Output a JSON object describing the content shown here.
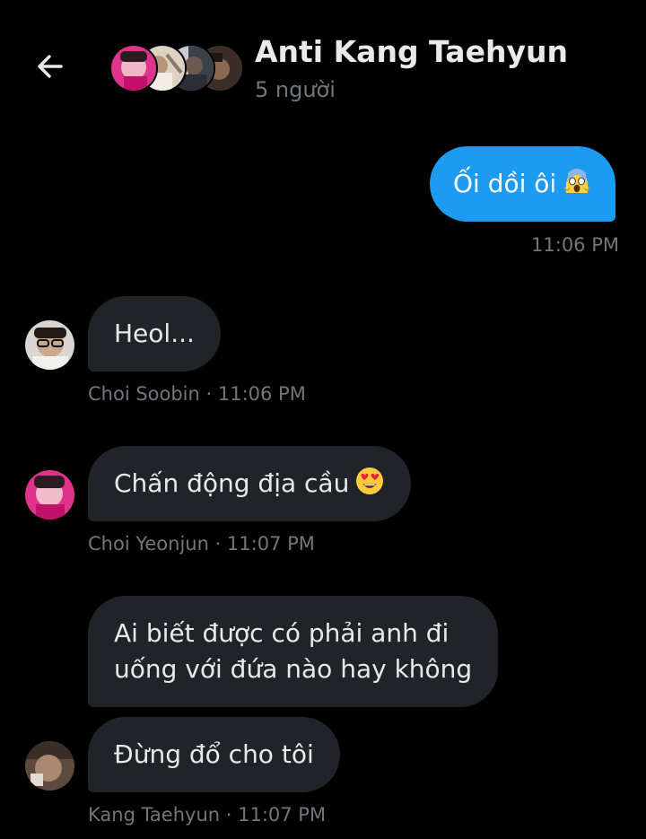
{
  "header": {
    "title": "Anti Kang Taehyun",
    "subtitle": "5 người",
    "back_icon": "arrow-left-icon",
    "group_avatar_count": 4
  },
  "colors": {
    "background": "#000000",
    "sent_bubble": "#1d9bf0",
    "received_bubble": "#202327",
    "primary_text": "#e7e9ea",
    "secondary_text": "#71767b"
  },
  "messages": [
    {
      "sender": "me",
      "text": "Ối dồi ôi",
      "emoji": "scream-emoji",
      "time": "11:06 PM"
    },
    {
      "sender": "Choi Soobin",
      "text": "Heol...",
      "meta": "Choi Soobin · 11:06 PM"
    },
    {
      "sender": "Choi Yeonjun",
      "text": "Chấn động địa cầu",
      "emoji": "heart-eyes-emoji",
      "meta": "Choi Yeonjun · 11:07 PM"
    },
    {
      "sender": "Kang Taehyun",
      "lines": [
        "Ai biết được có phải anh đi",
        "uống với đứa nào hay không"
      ]
    },
    {
      "sender": "Kang Taehyun",
      "text": "Đừng đổ cho tôi",
      "meta": "Kang Taehyun · 11:07 PM"
    }
  ]
}
